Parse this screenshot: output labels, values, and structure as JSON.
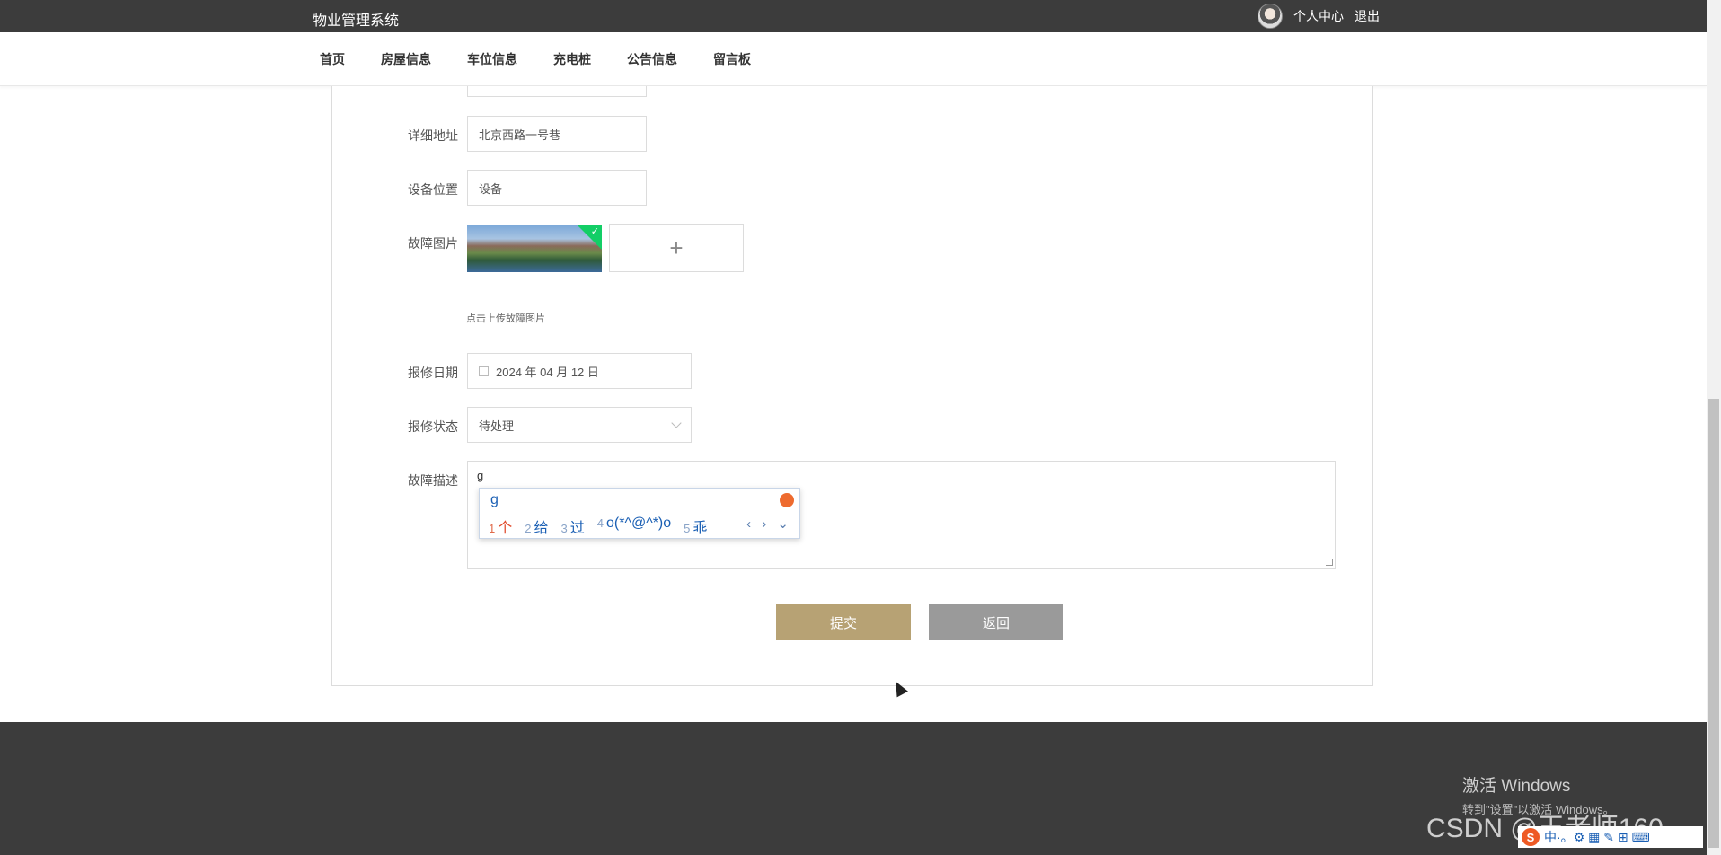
{
  "header": {
    "brand": "物业管理系统",
    "user_center": "个人中心",
    "logout": "退出"
  },
  "nav": {
    "items": [
      "首页",
      "房屋信息",
      "车位信息",
      "充电桩",
      "公告信息",
      "留言板"
    ]
  },
  "form": {
    "address_label": "详细地址",
    "address_value": "北京西路一号巷",
    "device_location_label": "设备位置",
    "device_location_value": "设备",
    "fault_image_label": "故障图片",
    "upload_plus": "+",
    "upload_hint": "点击上传故障图片",
    "repair_date_label": "报修日期",
    "repair_date_value": "2024 年 04 月 12 日",
    "repair_status_label": "报修状态",
    "repair_status_value": "待处理",
    "fault_desc_label": "故障描述",
    "fault_desc_value": "g",
    "submit": "提交",
    "back": "返回"
  },
  "ime": {
    "pinyin": "g",
    "candidates": [
      {
        "n": "1",
        "w": "个"
      },
      {
        "n": "2",
        "w": "给"
      },
      {
        "n": "3",
        "w": "过"
      },
      {
        "n": "4",
        "w": "o(*^@^*)o"
      },
      {
        "n": "5",
        "w": "乖"
      }
    ],
    "nav": "‹ › ⌄"
  },
  "overlay": {
    "activation_title": "激活 Windows",
    "activation_sub": "转到\"设置\"以激活 Windows。",
    "watermark": "CSDN @王老师160",
    "taskbar_ime_logo": "S",
    "taskbar_ime_text": "中·。⚙ ▦ ✎ ⊞ ⌨"
  },
  "colors": {
    "topbar": "#3c3c3c",
    "submit_button": "#b7a274",
    "back_button": "#9a9a9a",
    "upload_success": "#13ce66"
  }
}
